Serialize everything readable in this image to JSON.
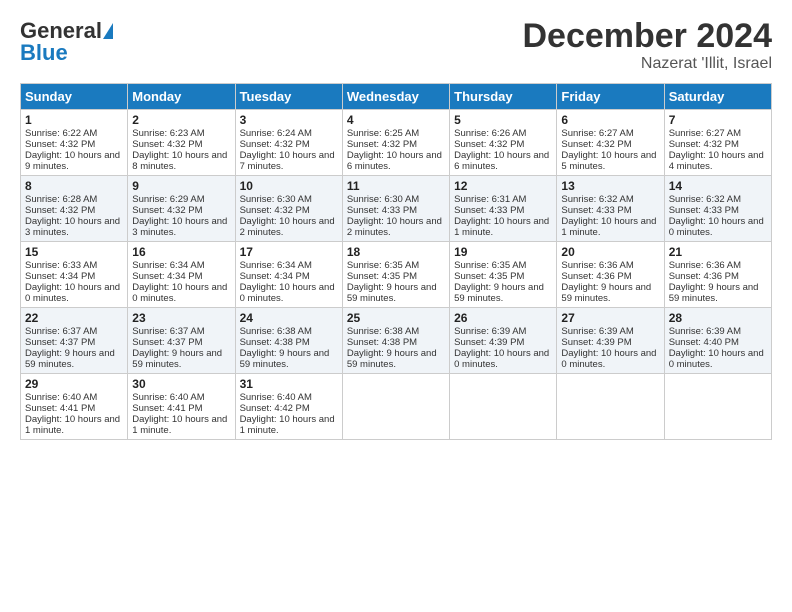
{
  "header": {
    "logo_general": "General",
    "logo_blue": "Blue",
    "main_title": "December 2024",
    "subtitle": "Nazerat 'Illit, Israel"
  },
  "days": [
    "Sunday",
    "Monday",
    "Tuesday",
    "Wednesday",
    "Thursday",
    "Friday",
    "Saturday"
  ],
  "weeks": [
    [
      {
        "num": "1",
        "sunrise": "6:22 AM",
        "sunset": "4:32 PM",
        "daylight": "10 hours and 9 minutes."
      },
      {
        "num": "2",
        "sunrise": "6:23 AM",
        "sunset": "4:32 PM",
        "daylight": "10 hours and 8 minutes."
      },
      {
        "num": "3",
        "sunrise": "6:24 AM",
        "sunset": "4:32 PM",
        "daylight": "10 hours and 7 minutes."
      },
      {
        "num": "4",
        "sunrise": "6:25 AM",
        "sunset": "4:32 PM",
        "daylight": "10 hours and 6 minutes."
      },
      {
        "num": "5",
        "sunrise": "6:26 AM",
        "sunset": "4:32 PM",
        "daylight": "10 hours and 6 minutes."
      },
      {
        "num": "6",
        "sunrise": "6:27 AM",
        "sunset": "4:32 PM",
        "daylight": "10 hours and 5 minutes."
      },
      {
        "num": "7",
        "sunrise": "6:27 AM",
        "sunset": "4:32 PM",
        "daylight": "10 hours and 4 minutes."
      }
    ],
    [
      {
        "num": "8",
        "sunrise": "6:28 AM",
        "sunset": "4:32 PM",
        "daylight": "10 hours and 3 minutes."
      },
      {
        "num": "9",
        "sunrise": "6:29 AM",
        "sunset": "4:32 PM",
        "daylight": "10 hours and 3 minutes."
      },
      {
        "num": "10",
        "sunrise": "6:30 AM",
        "sunset": "4:32 PM",
        "daylight": "10 hours and 2 minutes."
      },
      {
        "num": "11",
        "sunrise": "6:30 AM",
        "sunset": "4:33 PM",
        "daylight": "10 hours and 2 minutes."
      },
      {
        "num": "12",
        "sunrise": "6:31 AM",
        "sunset": "4:33 PM",
        "daylight": "10 hours and 1 minute."
      },
      {
        "num": "13",
        "sunrise": "6:32 AM",
        "sunset": "4:33 PM",
        "daylight": "10 hours and 1 minute."
      },
      {
        "num": "14",
        "sunrise": "6:32 AM",
        "sunset": "4:33 PM",
        "daylight": "10 hours and 0 minutes."
      }
    ],
    [
      {
        "num": "15",
        "sunrise": "6:33 AM",
        "sunset": "4:34 PM",
        "daylight": "10 hours and 0 minutes."
      },
      {
        "num": "16",
        "sunrise": "6:34 AM",
        "sunset": "4:34 PM",
        "daylight": "10 hours and 0 minutes."
      },
      {
        "num": "17",
        "sunrise": "6:34 AM",
        "sunset": "4:34 PM",
        "daylight": "10 hours and 0 minutes."
      },
      {
        "num": "18",
        "sunrise": "6:35 AM",
        "sunset": "4:35 PM",
        "daylight": "9 hours and 59 minutes."
      },
      {
        "num": "19",
        "sunrise": "6:35 AM",
        "sunset": "4:35 PM",
        "daylight": "9 hours and 59 minutes."
      },
      {
        "num": "20",
        "sunrise": "6:36 AM",
        "sunset": "4:36 PM",
        "daylight": "9 hours and 59 minutes."
      },
      {
        "num": "21",
        "sunrise": "6:36 AM",
        "sunset": "4:36 PM",
        "daylight": "9 hours and 59 minutes."
      }
    ],
    [
      {
        "num": "22",
        "sunrise": "6:37 AM",
        "sunset": "4:37 PM",
        "daylight": "9 hours and 59 minutes."
      },
      {
        "num": "23",
        "sunrise": "6:37 AM",
        "sunset": "4:37 PM",
        "daylight": "9 hours and 59 minutes."
      },
      {
        "num": "24",
        "sunrise": "6:38 AM",
        "sunset": "4:38 PM",
        "daylight": "9 hours and 59 minutes."
      },
      {
        "num": "25",
        "sunrise": "6:38 AM",
        "sunset": "4:38 PM",
        "daylight": "9 hours and 59 minutes."
      },
      {
        "num": "26",
        "sunrise": "6:39 AM",
        "sunset": "4:39 PM",
        "daylight": "10 hours and 0 minutes."
      },
      {
        "num": "27",
        "sunrise": "6:39 AM",
        "sunset": "4:39 PM",
        "daylight": "10 hours and 0 minutes."
      },
      {
        "num": "28",
        "sunrise": "6:39 AM",
        "sunset": "4:40 PM",
        "daylight": "10 hours and 0 minutes."
      }
    ],
    [
      {
        "num": "29",
        "sunrise": "6:40 AM",
        "sunset": "4:41 PM",
        "daylight": "10 hours and 1 minute."
      },
      {
        "num": "30",
        "sunrise": "6:40 AM",
        "sunset": "4:41 PM",
        "daylight": "10 hours and 1 minute."
      },
      {
        "num": "31",
        "sunrise": "6:40 AM",
        "sunset": "4:42 PM",
        "daylight": "10 hours and 1 minute."
      },
      null,
      null,
      null,
      null
    ]
  ],
  "labels": {
    "sunrise": "Sunrise:",
    "sunset": "Sunset:",
    "daylight": "Daylight:"
  }
}
